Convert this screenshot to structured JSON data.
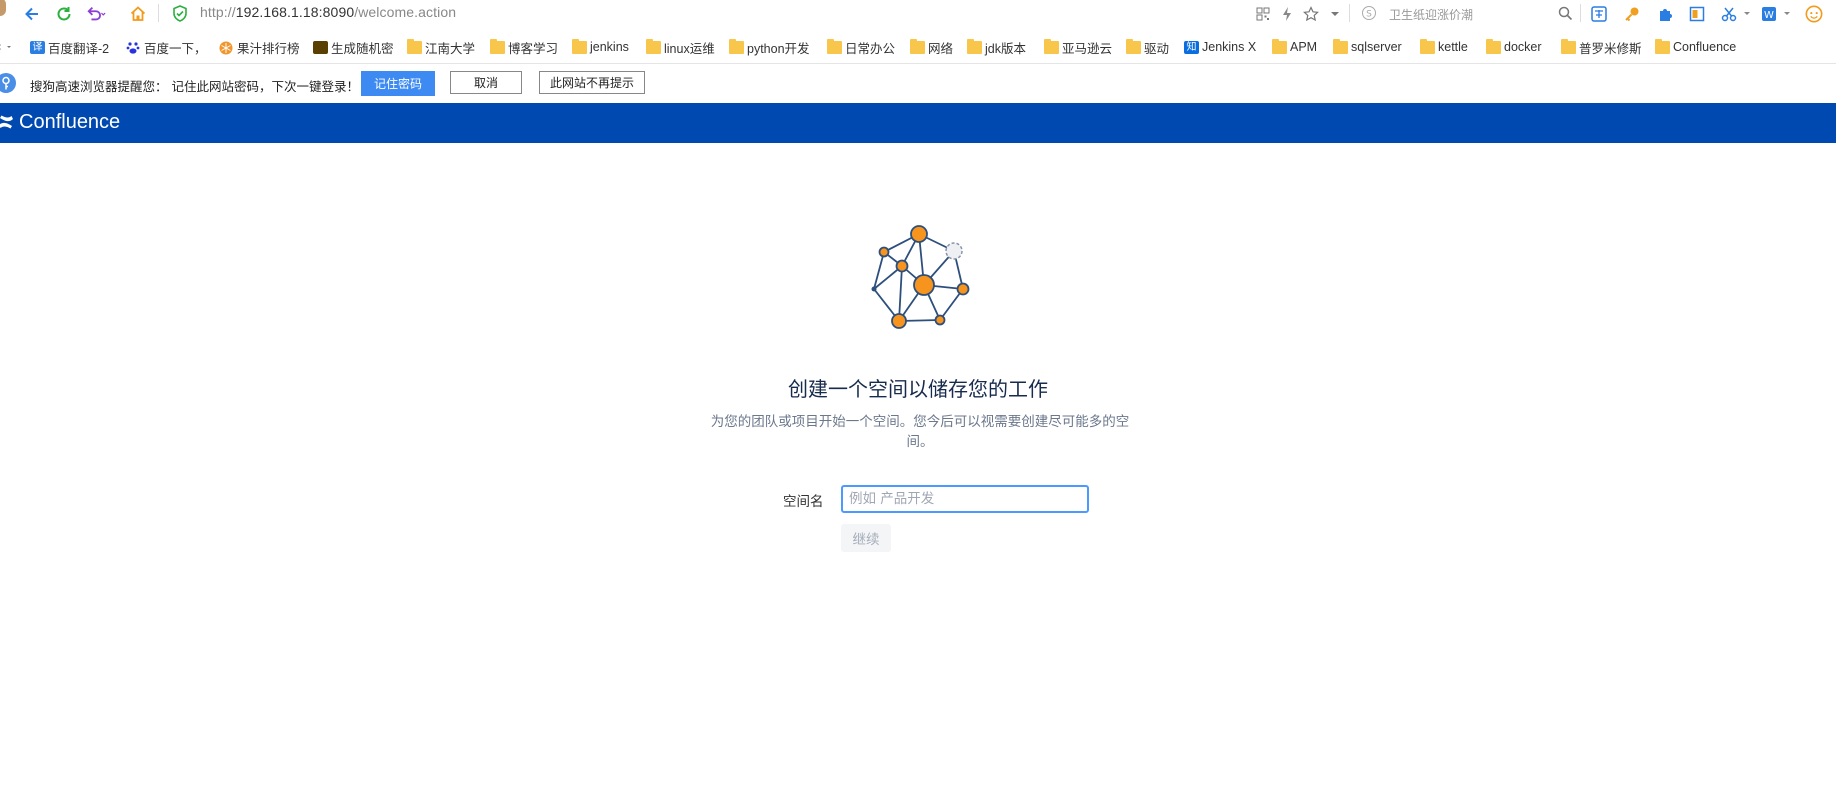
{
  "browser": {
    "url_scheme": "http://",
    "url_host": "192.168.1.18:8090",
    "url_path": "/welcome.action",
    "search_placeholder": "卫生纸迎涨价潮"
  },
  "bookmarks": [
    {
      "label": "百度翻译-2",
      "icon": "translate-icon"
    },
    {
      "label": "百度一下，",
      "icon": "baidu-icon"
    },
    {
      "label": "果汁排行榜",
      "icon": "fruit-icon"
    },
    {
      "label": "生成随机密",
      "icon": "generator-icon"
    },
    {
      "label": "江南大学",
      "icon": "folder-icon"
    },
    {
      "label": "博客学习",
      "icon": "folder-icon"
    },
    {
      "label": "jenkins",
      "icon": "folder-icon"
    },
    {
      "label": "linux运维",
      "icon": "folder-icon"
    },
    {
      "label": "python开发",
      "icon": "folder-icon"
    },
    {
      "label": "日常办公",
      "icon": "folder-icon"
    },
    {
      "label": "网络",
      "icon": "folder-icon"
    },
    {
      "label": "jdk版本",
      "icon": "folder-icon"
    },
    {
      "label": "亚马逊云",
      "icon": "folder-icon"
    },
    {
      "label": "驱动",
      "icon": "folder-icon"
    },
    {
      "label": "Jenkins X",
      "icon": "zhihu-icon"
    },
    {
      "label": "APM",
      "icon": "folder-icon"
    },
    {
      "label": "sqlserver",
      "icon": "folder-icon"
    },
    {
      "label": "kettle",
      "icon": "folder-icon"
    },
    {
      "label": "docker",
      "icon": "folder-icon"
    },
    {
      "label": "普罗米修斯",
      "icon": "folder-icon"
    },
    {
      "label": "Confluence",
      "icon": "folder-icon"
    }
  ],
  "password_bar": {
    "message": "搜狗高速浏览器提醒您：  记住此网站密码，下次一键登录！",
    "remember": "记住密码",
    "cancel": "取消",
    "never": "此网站不再提示"
  },
  "header": {
    "app_name": "Confluence",
    "color": "#0049b0"
  },
  "main": {
    "title": "创建一个空间以储存您的工作",
    "description": "为您的团队或项目开始一个空间。您今后可以视需要创建尽可能多的空间。",
    "space_label": "空间名",
    "space_placeholder": "例如 产品开发",
    "space_value": "",
    "continue": "继续"
  }
}
